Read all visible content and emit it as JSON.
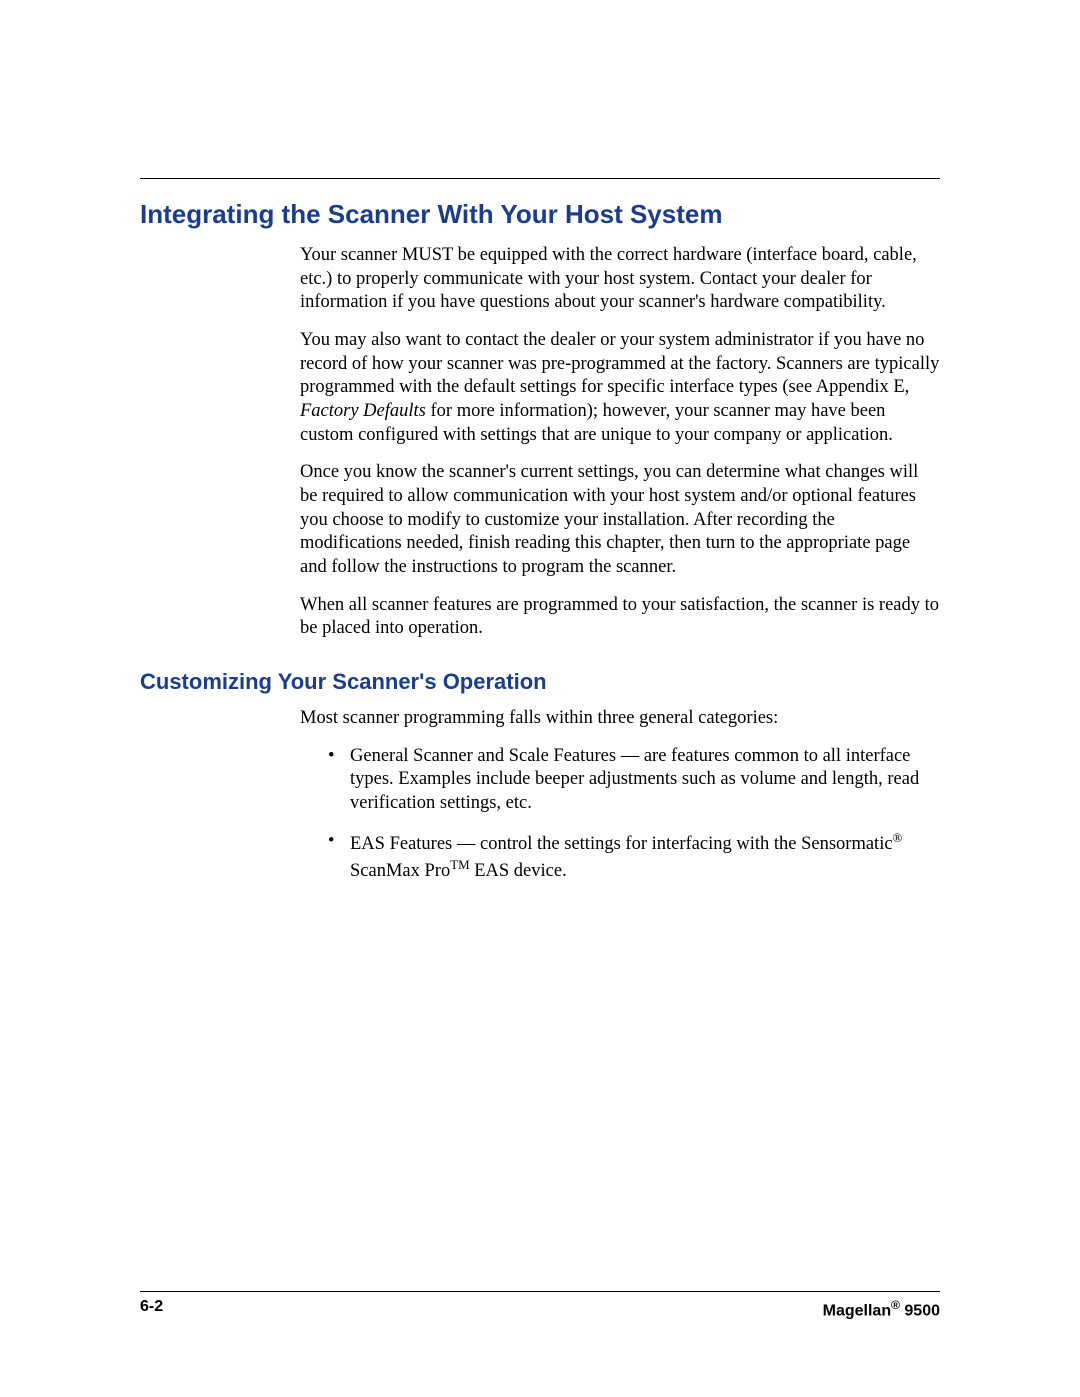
{
  "heading1": "Integrating the Scanner With Your Host System",
  "para1": "Your scanner MUST be equipped with the correct hardware (interface board, cable, etc.) to properly communicate with your host system. Contact your dealer for information if you have questions about your scanner's hardware compatibility.",
  "para2a": "You may also want to contact the dealer or your system administrator if you have no record of how your scanner was pre-programmed at the factory. Scanners are typically programmed with the default settings for specific interface types (see Appendix E, ",
  "para2_ital": "Factory Defaults",
  "para2b": " for more information); however, your scanner may have been custom configured with settings that are unique to your company or application.",
  "para3": "Once you know the scanner's current settings, you can determine what changes will be required to allow communication with your host system and/or optional features you choose to modify to customize your installation. After recording the modifications needed, finish reading this chapter, then turn to the appropriate page and follow the instructions to program the scanner.",
  "para4": "When all scanner features are programmed to your satisfaction, the scanner is ready to be placed into operation.",
  "heading2": "Customizing Your Scanner's Operation",
  "para5": "Most scanner programming falls within three general categories:",
  "bullet1": "General Scanner and Scale Features — are features common to all interface types. Examples include beeper adjustments such as volume and length, read verification settings, etc.",
  "bullet2a": "EAS Features — control the settings for interfacing with the Sensormatic",
  "bullet2_reg1": "®",
  "bullet2b": " ScanMax Pro",
  "bullet2_tm": "TM",
  "bullet2c": " EAS device.",
  "footer": {
    "left": "6-2",
    "right_a": "Magellan",
    "right_reg": "®",
    "right_b": " 9500"
  }
}
